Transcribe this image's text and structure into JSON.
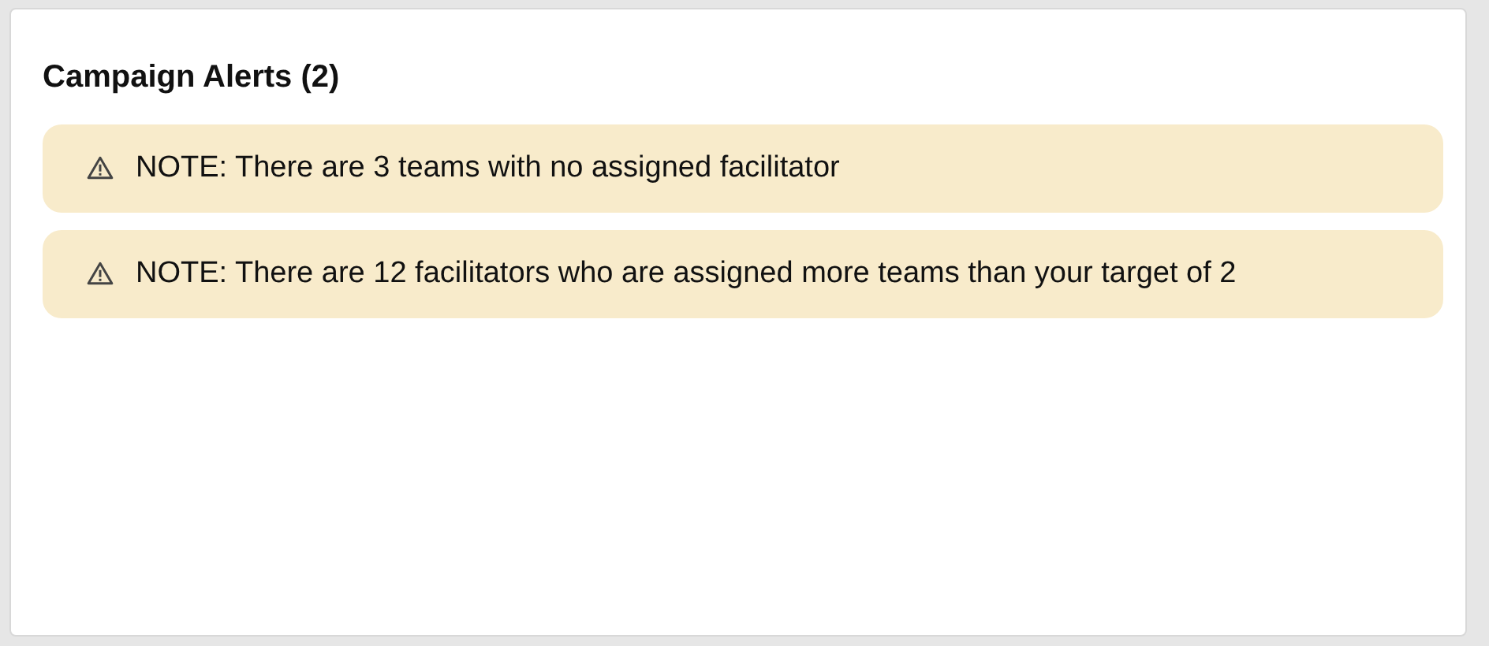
{
  "card": {
    "title": "Campaign Alerts (2)",
    "alerts": [
      {
        "text": "NOTE: There are 3 teams with no assigned facilitator"
      },
      {
        "text": "NOTE: There are 12 facilitators who are assigned more teams than your target of 2"
      }
    ]
  }
}
